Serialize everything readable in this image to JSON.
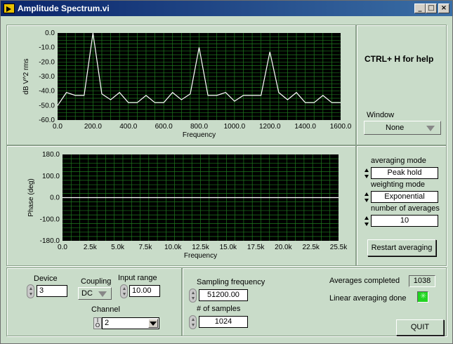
{
  "window": {
    "title": "Amplitude Spectrum.vi",
    "min": "_",
    "max": "□",
    "close": "×"
  },
  "help": "CTRL+ H for help",
  "window_fn": {
    "label": "Window",
    "value": "None"
  },
  "averaging": {
    "mode_label": "averaging mode",
    "mode_value": "Peak hold",
    "weight_label": "weighting mode",
    "weight_value": "Exponential",
    "num_label": "number of averages",
    "num_value": "10",
    "restart": "Restart averaging"
  },
  "daq": {
    "device_label": "Device",
    "device_value": "3",
    "coupling_label": "Coupling",
    "coupling_value": "DC",
    "range_label": "Input range",
    "range_value": "10.00",
    "channel_label": "Channel",
    "channel_value": "2"
  },
  "sampling": {
    "freq_label": "Sampling frequency",
    "freq_value": "51200.00",
    "samples_label": "# of samples",
    "samples_value": "1024"
  },
  "status": {
    "avg_label": "Averages completed",
    "avg_value": "1038",
    "linear_label": "Linear averaging done",
    "led_color": "#21d421"
  },
  "quit": "QUIT",
  "chart_data": [
    {
      "type": "line",
      "xlabel": "Frequency",
      "ylabel": "dB V^2 rms",
      "xlim": [
        0,
        1600
      ],
      "ylim": [
        -60,
        0
      ],
      "xticks": [
        "0.0",
        "200.0",
        "400.0",
        "600.0",
        "800.0",
        "1000.0",
        "1200.0",
        "1400.0",
        "1600.0"
      ],
      "yticks": [
        "0.0",
        "-10.0",
        "-20.0",
        "-30.0",
        "-40.0",
        "-50.0",
        "-60.0"
      ],
      "x": [
        0,
        50,
        100,
        150,
        200,
        250,
        300,
        350,
        400,
        450,
        500,
        550,
        600,
        650,
        700,
        750,
        800,
        850,
        900,
        950,
        1000,
        1050,
        1100,
        1150,
        1200,
        1250,
        1300,
        1350,
        1400,
        1450,
        1500,
        1550,
        1600
      ],
      "series": [
        {
          "values": [
            -50,
            -41,
            -43,
            -43,
            0,
            -42,
            -46,
            -41,
            -48,
            -48,
            -43,
            -48,
            -48,
            -41,
            -46,
            -42,
            -10,
            -43,
            -43,
            -41,
            -47,
            -43,
            -43,
            -43,
            -13,
            -41,
            -46,
            -41,
            -48,
            -48,
            -43,
            -48,
            -48
          ]
        }
      ],
      "grid": true,
      "colors": {
        "bg": "#000000",
        "grid": "#1f7a1f",
        "line": "#ffffff"
      }
    },
    {
      "type": "line",
      "xlabel": "Frequency",
      "ylabel": "Phase (deg)",
      "xlim": [
        0,
        25500
      ],
      "ylim": [
        -180,
        180
      ],
      "xticks": [
        "0.0",
        "2.5k",
        "5.0k",
        "7.5k",
        "10.0k",
        "12.5k",
        "15.0k",
        "17.5k",
        "20.0k",
        "22.5k",
        "25.5k"
      ],
      "yticks": [
        "180.0",
        "100.0",
        "0.0",
        "-100.0",
        "-180.0"
      ],
      "x": [
        0,
        25500
      ],
      "series": [
        {
          "values": [
            0,
            0
          ]
        }
      ],
      "grid": true,
      "colors": {
        "bg": "#000000",
        "grid": "#1f7a1f",
        "line": "#ffffff"
      }
    }
  ]
}
